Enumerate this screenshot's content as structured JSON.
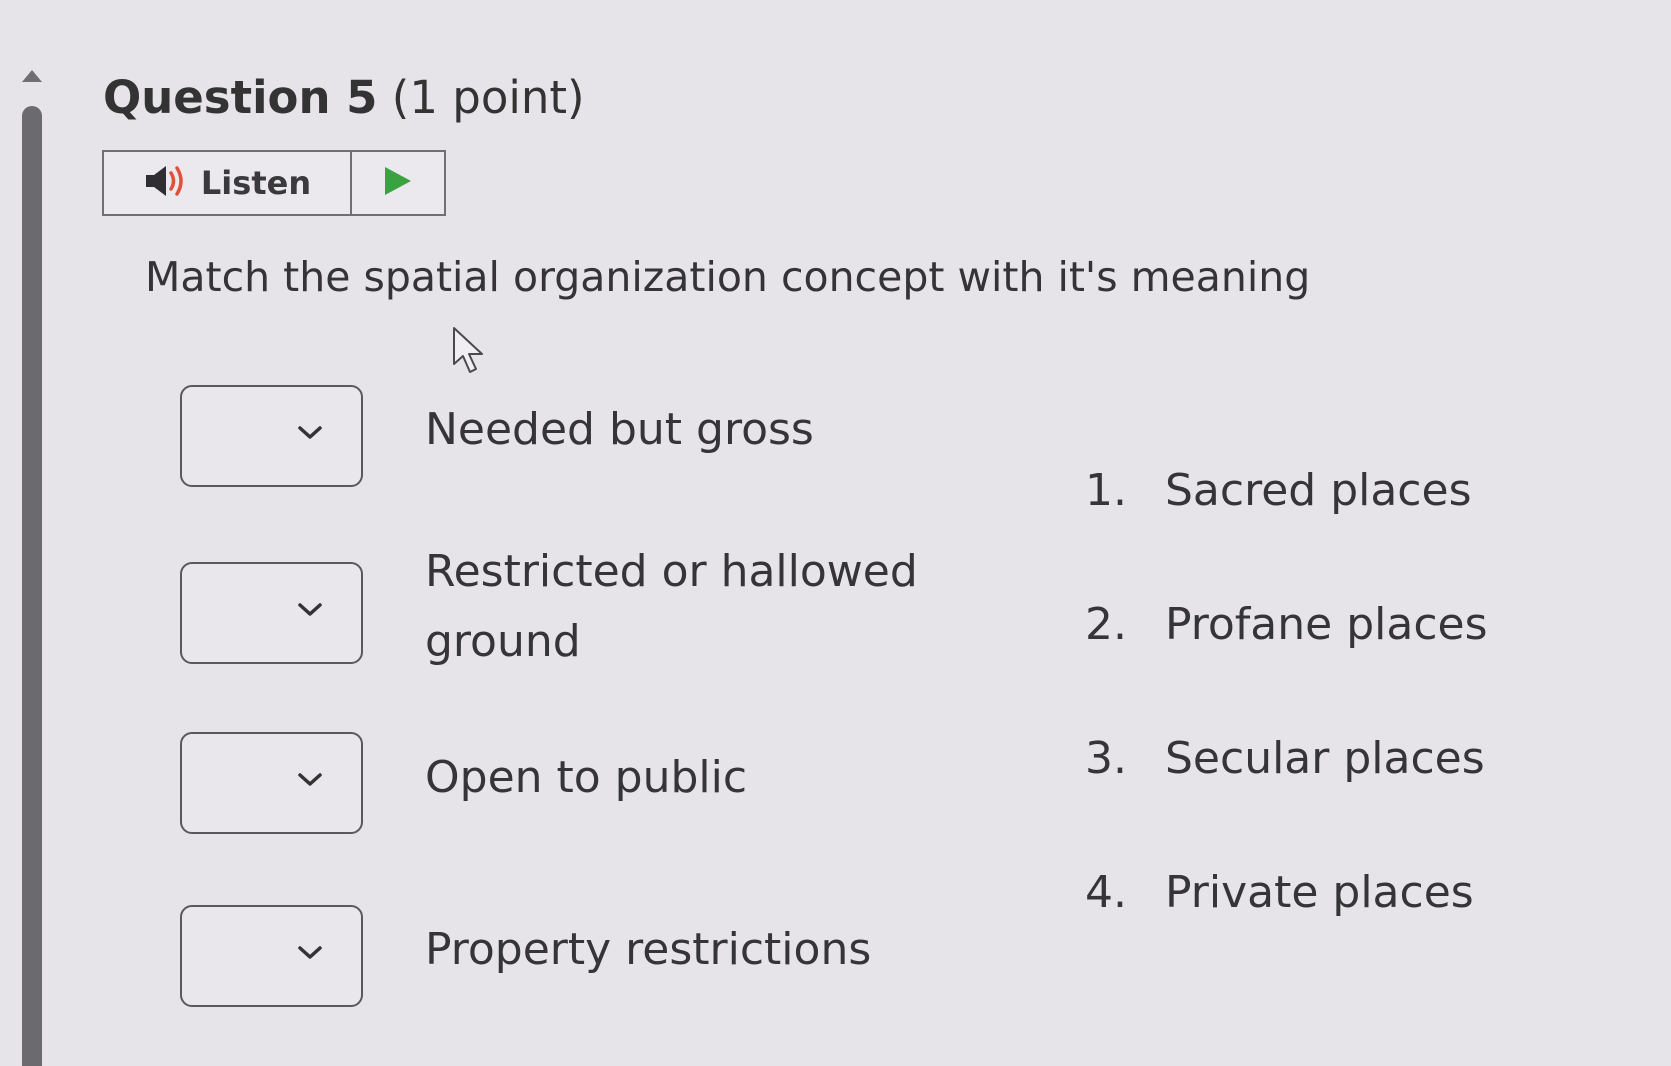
{
  "question": {
    "number_label": "Question 5",
    "points_label": "(1 point)"
  },
  "listen": {
    "label": "Listen",
    "speaker_icon": "speaker-icon",
    "play_icon": "play-icon",
    "play_color": "#3aa241"
  },
  "prompt": "Match the spatial organization concept with it's meaning",
  "items": [
    {
      "selected": "",
      "text": "Needed but gross"
    },
    {
      "selected": "",
      "text": "Restricted or hallowed ground"
    },
    {
      "selected": "",
      "text": "Open to public"
    },
    {
      "selected": "",
      "text": "Property restrictions"
    }
  ],
  "answers": [
    {
      "number": "1.",
      "label": "Sacred places"
    },
    {
      "number": "2.",
      "label": "Profane places"
    },
    {
      "number": "3.",
      "label": "Secular places"
    },
    {
      "number": "4.",
      "label": "Private places"
    }
  ]
}
